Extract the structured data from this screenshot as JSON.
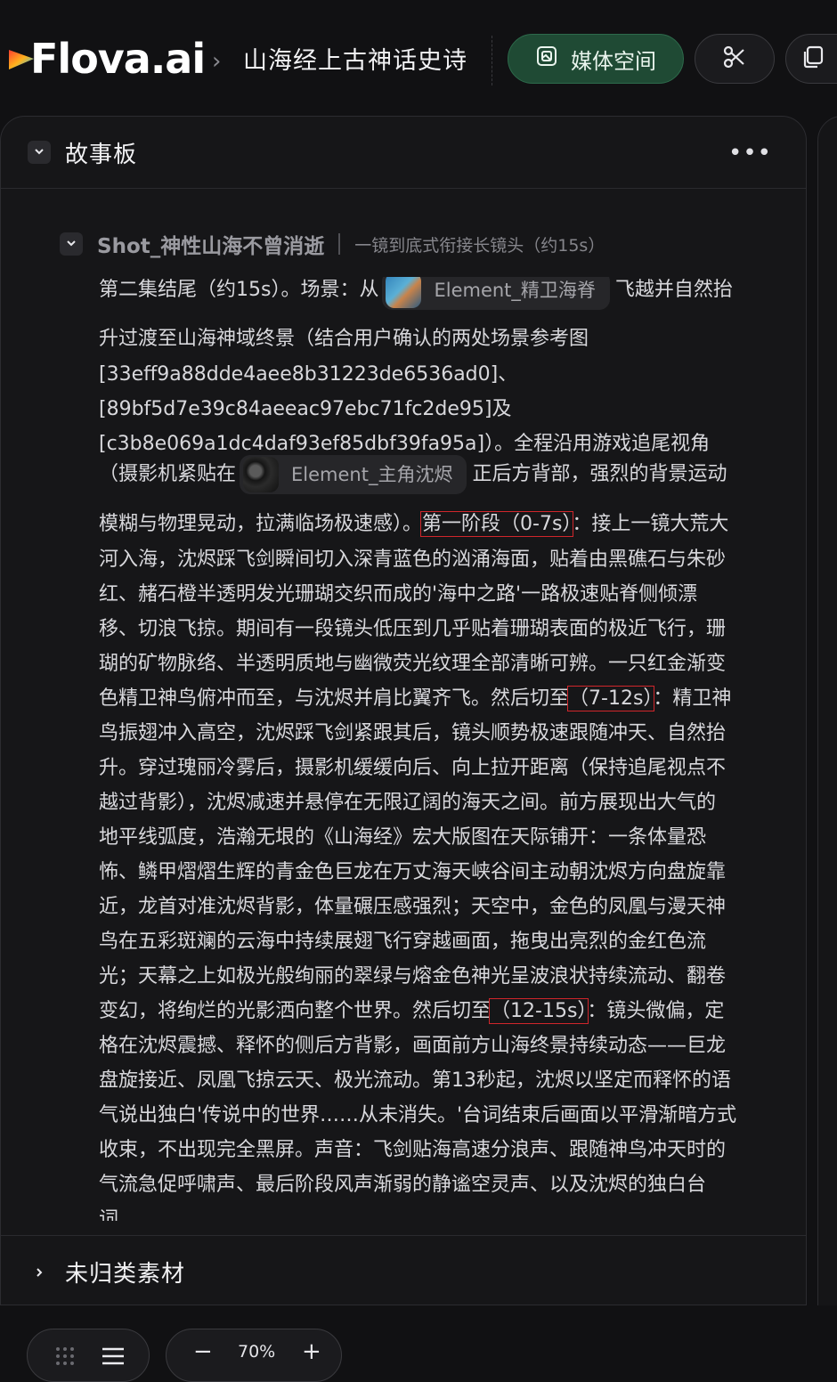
{
  "app": {
    "logo_text": "Flova.ai",
    "breadcrumb_sep": "›",
    "project_title": "山海经上古神话史诗",
    "media_button_label": "媒体空间",
    "media_icon": "media-icon",
    "cut_icon": "scissors-icon",
    "copy_icon": "copy-icon",
    "accent_color": "#1f4a34"
  },
  "storyboard": {
    "title": "故事板",
    "more_label": "•••",
    "shot": {
      "title": "Shot_神性山海不曾消逝",
      "subtitle": "一镜到底式衔接长镜头（约15s）",
      "lines": [
        {
          "a": "第二集结尾（约15s）。场景：从",
          "chip": "Element_精卫海脊",
          "b": "飞越并自然抬"
        },
        {
          "t": "升过渡至山海神域终景（结合用户确认的两处场景参考图"
        },
        {
          "t": "[33eff9a88dde4aee8b31223de6536ad0]、"
        },
        {
          "t": "[89bf5d7e39c84aeeac97ebc71fc2de95]及"
        },
        {
          "t": "[c3b8e069a1dc4daf93ef85dbf39fa95a]）。全程沿用游戏追尾视角"
        },
        {
          "a": "（摄影机紧贴在",
          "chip": "Element_主角沈烬",
          "b": "正后方背部，强烈的背景运动"
        },
        {
          "a": "模糊与物理晃动，拉满临场极速感）。",
          "hl": "第一阶段（0-7s）",
          "b": "：接上一镜大荒大"
        },
        {
          "t": "河入海，沈烬踩飞剑瞬间切入深青蓝色的汹涌海面，贴着由黑礁石与朱砂"
        },
        {
          "t": "红、赭石橙半透明发光珊瑚交织而成的'海中之路'一路极速贴脊侧倾漂"
        },
        {
          "t": "移、切浪飞掠。期间有一段镜头低压到几乎贴着珊瑚表面的极近飞行，珊"
        },
        {
          "t": "瑚的矿物脉络、半透明质地与幽微荧光纹理全部清晰可辨。一只红金渐变"
        },
        {
          "a": "色精卫神鸟俯冲而至，与沈烬并肩比翼齐飞。然后切至",
          "hl": "（7-12s）",
          "b": "：精卫神"
        },
        {
          "t": "鸟振翅冲入高空，沈烬踩飞剑紧跟其后，镜头顺势极速跟随冲天、自然抬"
        },
        {
          "t": "升。穿过瑰丽冷雾后，摄影机缓缓向后、向上拉开距离（保持追尾视点不"
        },
        {
          "t": "越过背影），沈烬减速并悬停在无限辽阔的海天之间。前方展现出大气的"
        },
        {
          "t": "地平线弧度，浩瀚无垠的《山海经》宏大版图在天际铺开：一条体量恐"
        },
        {
          "t": "怖、鳞甲熠熠生辉的青金色巨龙在万丈海天峡谷间主动朝沈烬方向盘旋靠"
        },
        {
          "t": "近，龙首对准沈烬背影，体量碾压感强烈；天空中，金色的凤凰与漫天神"
        },
        {
          "t": "鸟在五彩斑斓的云海中持续展翅飞行穿越画面，拖曳出亮烈的金红色流"
        },
        {
          "t": "光；天幕之上如极光般绚丽的翠绿与熔金色神光呈波浪状持续流动、翻卷"
        },
        {
          "a": "变幻，将绚烂的光影洒向整个世界。然后切至",
          "hl": "（12-15s）",
          "b": "：镜头微偏，定"
        },
        {
          "t": "格在沈烬震撼、释怀的侧后方背影，画面前方山海终景持续动态——巨龙"
        },
        {
          "t": "盘旋接近、凤凰飞掠云天、极光流动。第13秒起，沈烬以坚定而释怀的语"
        },
        {
          "t": "气说出独白'传说中的世界……从未消失。'台词结束后画面以平滑渐暗方式"
        },
        {
          "t": "收束，不出现完全黑屏。声音：飞剑贴海高速分浪声、跟随神鸟冲天时的"
        },
        {
          "t": "气流急促呼啸声、最后阶段风声渐弱的静谧空灵声、以及沈烬的独白台"
        },
        {
          "t": "词"
        }
      ]
    }
  },
  "uncategorized": {
    "title": "未归类素材"
  },
  "bottom_bar": {
    "grid_icon": "grid-dots-icon",
    "list_icon": "list-icon",
    "zoom_out": "−",
    "zoom_value": "70%",
    "zoom_in": "+"
  }
}
